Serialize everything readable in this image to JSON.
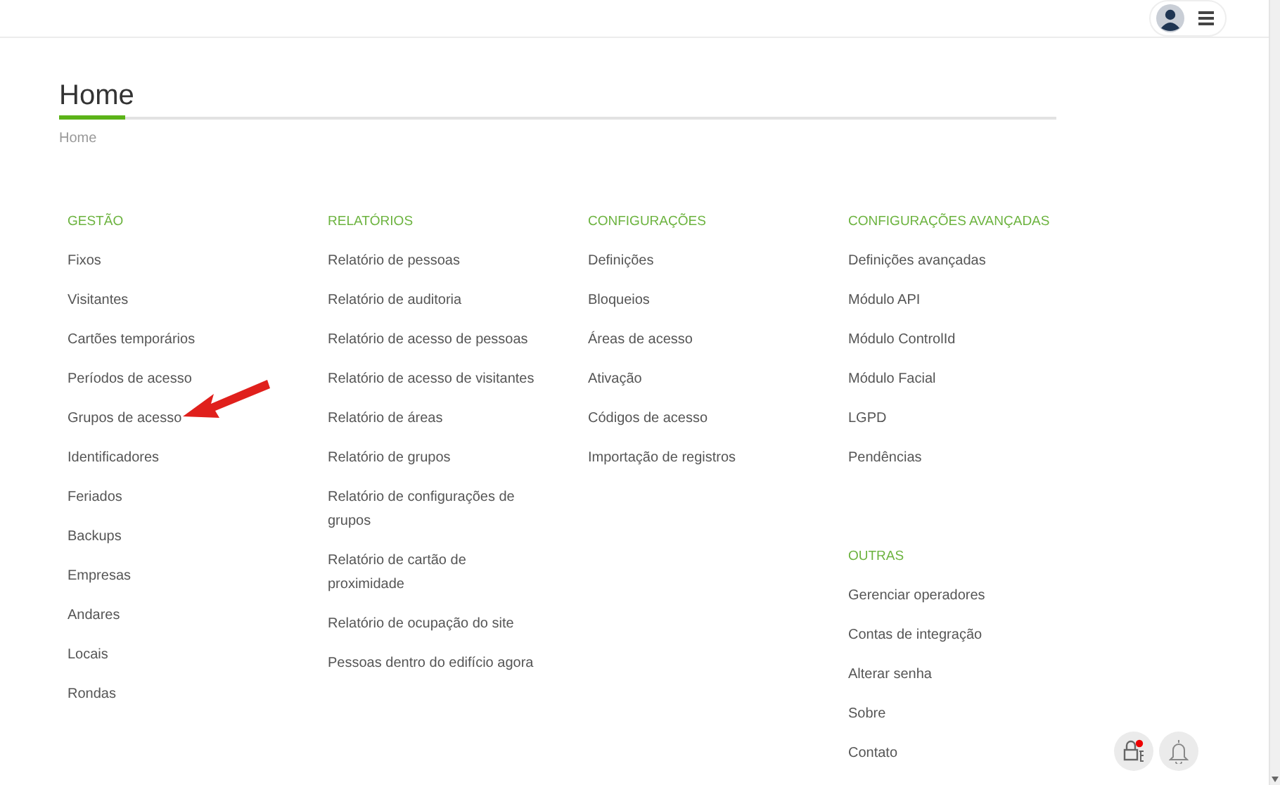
{
  "page": {
    "title": "Home",
    "breadcrumb": "Home"
  },
  "columns": [
    {
      "sections": [
        {
          "title": "GESTÃO",
          "items": [
            "Fixos",
            "Visitantes",
            "Cartões temporários",
            "Períodos de acesso",
            "Grupos de acesso",
            "Identificadores",
            "Feriados",
            "Backups",
            "Empresas",
            "Andares",
            "Locais",
            "Rondas"
          ]
        }
      ]
    },
    {
      "sections": [
        {
          "title": "RELATÓRIOS",
          "items": [
            "Relatório de pessoas",
            "Relatório de auditoria",
            "Relatório de acesso de pessoas",
            "Relatório de acesso de visitantes",
            "Relatório de áreas",
            "Relatório de grupos",
            "Relatório de configurações de grupos",
            "Relatório de cartão de proximidade",
            "Relatório de ocupação do site",
            "Pessoas dentro do edifício agora"
          ]
        }
      ]
    },
    {
      "sections": [
        {
          "title": "CONFIGURAÇÕES",
          "items": [
            "Definições",
            "Bloqueios",
            "Áreas de acesso",
            "Ativação",
            "Códigos de acesso",
            "Importação de registros"
          ]
        }
      ]
    },
    {
      "sections": [
        {
          "title": "CONFIGURAÇÕES AVANÇADAS",
          "items": [
            "Definições avançadas",
            "Módulo API",
            "Módulo ControlId",
            "Módulo Facial",
            "LGPD",
            "Pendências"
          ]
        },
        {
          "title": "OUTRAS",
          "items": [
            "Gerenciar operadores",
            "Contas de integração",
            "Alterar senha",
            "Sobre",
            "Contato"
          ]
        }
      ]
    }
  ]
}
